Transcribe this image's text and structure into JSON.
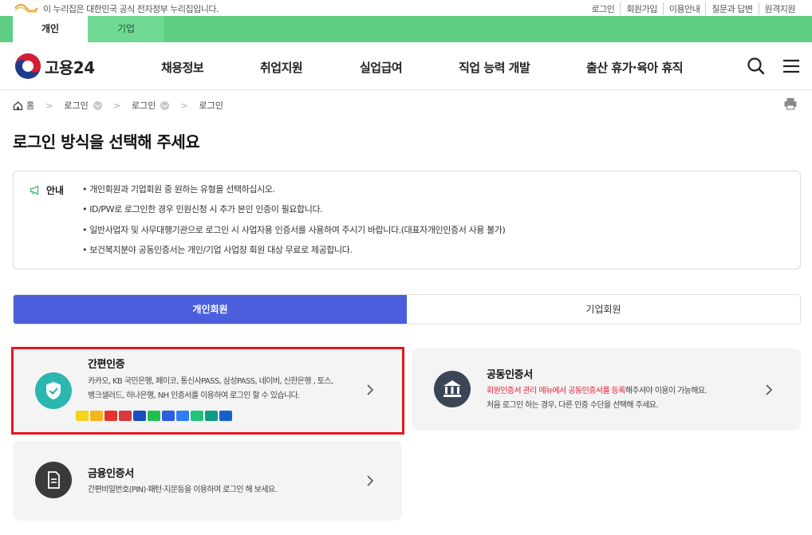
{
  "gov_banner": {
    "notice": "이 누리집은 대한민국 공식 전자정부 누리집입니다.",
    "links": [
      "로그인",
      "회원가입",
      "이용안내",
      "질문과 답변",
      "원격지원"
    ]
  },
  "user_type_tabs": [
    "개인",
    "기업"
  ],
  "header": {
    "logo_text": "고용24",
    "nav": [
      "채용정보",
      "취업지원",
      "실업급여",
      "직업 능력 개발",
      "출산 휴가·육아 휴직"
    ]
  },
  "breadcrumb": [
    "홈",
    "로그인",
    "로그인",
    "로그인"
  ],
  "page_title": "로그인 방식을 선택해 주세요",
  "notice": {
    "label": "안내",
    "items": [
      "개인회원과 기업회원 중 원하는 유형을 선택하십시오.",
      "ID/PW로 로그인한 경우 민원신청 시 추가 본인 인증이 필요합니다.",
      "일반사업자 및 사무대행기관으로 로그인 시 사업자용 인증서를 사용하여 주시기 바랍니다.(대표자개인인증서 사용 불가)",
      "보건복지분야 공동인증서는 개인/기업 사업장 회원 대상 무료로 제공합니다."
    ]
  },
  "member_tabs": {
    "active": "개인회원",
    "inactive": "기업회원"
  },
  "cards": {
    "simple": {
      "title": "간편인증",
      "desc_line1": "카카오, KB 국민은행, 페이코, 통신사PASS, 삼성PASS, 네이버, 신한은행 , 토스,",
      "desc_line2": "뱅크샐러드, 하나은행, NH 인증서를 이용하여 로그인 할 수 있습니다."
    },
    "joint": {
      "title": "공동인증서",
      "desc_red": "회원인증서 관리 메뉴에서 공동인증서를 등록",
      "desc_rest": "해주셔야 이용이 가능해요.",
      "desc_line2": "처음 로그인 하는 경우, 다른 인증 수단을 선택해 주세요."
    },
    "finance": {
      "title": "금융인증서",
      "desc": "간편비밀번호(PIN)·패턴·지문등을 이용하여 로그인 해 보세요."
    }
  },
  "provider_icons": [
    {
      "name": "kakao-icon",
      "color": "#f7d31c"
    },
    {
      "name": "kb-icon",
      "color": "#f5b51c"
    },
    {
      "name": "payco-icon",
      "color": "#e8322b"
    },
    {
      "name": "pass-icon",
      "color": "#d73a3a"
    },
    {
      "name": "samsung-pass-icon",
      "color": "#1a4fbf"
    },
    {
      "name": "naver-icon",
      "color": "#1fbf4b"
    },
    {
      "name": "shinhan-icon",
      "color": "#2b5ee0"
    },
    {
      "name": "toss-icon",
      "color": "#2d7ef2"
    },
    {
      "name": "banksalad-icon",
      "color": "#22c27a"
    },
    {
      "name": "hana-icon",
      "color": "#0f9a86"
    },
    {
      "name": "nh-icon",
      "color": "#1560c9"
    }
  ],
  "colors": {
    "accent_green": "#5fcf83",
    "tab_blue": "#4b5fdc",
    "highlight_red": "#e8151c"
  }
}
